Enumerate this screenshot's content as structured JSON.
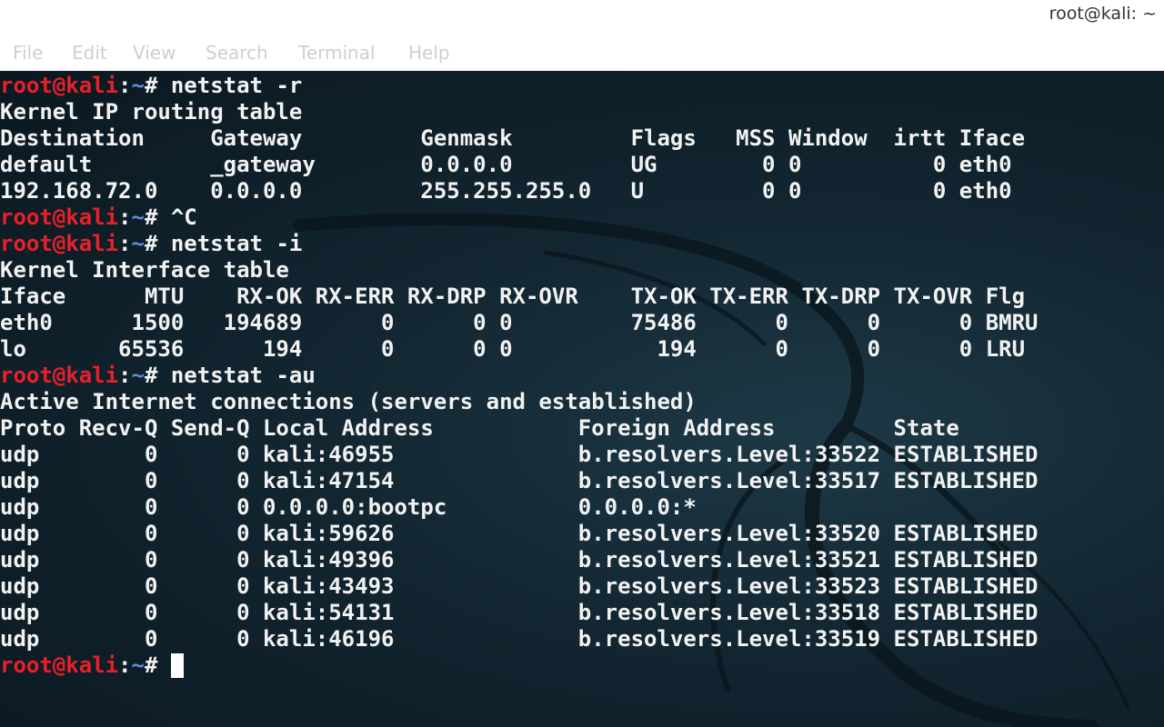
{
  "window": {
    "title": "root@kali: ~"
  },
  "menu": {
    "items": [
      "File",
      "Edit",
      "View",
      "Search",
      "Terminal",
      "Help"
    ]
  },
  "prompt": {
    "user": "root@kali",
    "separator": ":",
    "path": "~",
    "symbol": "# "
  },
  "colors": {
    "prompt_user": "#e8202b",
    "prompt_path": "#5a8fd6",
    "text": "#f2f2f2",
    "background": "#122530"
  },
  "terminal": {
    "lines": [
      {
        "type": "prompt",
        "command": "netstat -r"
      },
      {
        "type": "output",
        "text": "Kernel IP routing table"
      },
      {
        "type": "output",
        "text": "Destination     Gateway         Genmask         Flags   MSS Window  irtt Iface"
      },
      {
        "type": "output",
        "text": "default         _gateway        0.0.0.0         UG        0 0          0 eth0"
      },
      {
        "type": "output",
        "text": "192.168.72.0    0.0.0.0         255.255.255.0   U         0 0          0 eth0"
      },
      {
        "type": "prompt",
        "command": "^C"
      },
      {
        "type": "prompt",
        "command": "netstat -i"
      },
      {
        "type": "output",
        "text": "Kernel Interface table"
      },
      {
        "type": "output",
        "text": "Iface      MTU    RX-OK RX-ERR RX-DRP RX-OVR    TX-OK TX-ERR TX-DRP TX-OVR Flg"
      },
      {
        "type": "output",
        "text": "eth0      1500   194689      0      0 0         75486      0      0      0 BMRU"
      },
      {
        "type": "output",
        "text": "lo       65536      194      0      0 0           194      0      0      0 LRU"
      },
      {
        "type": "prompt",
        "command": "netstat -au"
      },
      {
        "type": "output",
        "text": "Active Internet connections (servers and established)"
      },
      {
        "type": "output",
        "text": "Proto Recv-Q Send-Q Local Address           Foreign Address         State"
      },
      {
        "type": "output",
        "text": "udp        0      0 kali:46955              b.resolvers.Level:33522 ESTABLISHED"
      },
      {
        "type": "output",
        "text": "udp        0      0 kali:47154              b.resolvers.Level:33517 ESTABLISHED"
      },
      {
        "type": "output",
        "text": "udp        0      0 0.0.0.0:bootpc          0.0.0.0:*"
      },
      {
        "type": "output",
        "text": "udp        0      0 kali:59626              b.resolvers.Level:33520 ESTABLISHED"
      },
      {
        "type": "output",
        "text": "udp        0      0 kali:49396              b.resolvers.Level:33521 ESTABLISHED"
      },
      {
        "type": "output",
        "text": "udp        0      0 kali:43493              b.resolvers.Level:33523 ESTABLISHED"
      },
      {
        "type": "output",
        "text": "udp        0      0 kali:54131              b.resolvers.Level:33518 ESTABLISHED"
      },
      {
        "type": "output",
        "text": "udp        0      0 kali:46196              b.resolvers.Level:33519 ESTABLISHED"
      },
      {
        "type": "prompt",
        "command": "",
        "cursor": true
      }
    ]
  }
}
